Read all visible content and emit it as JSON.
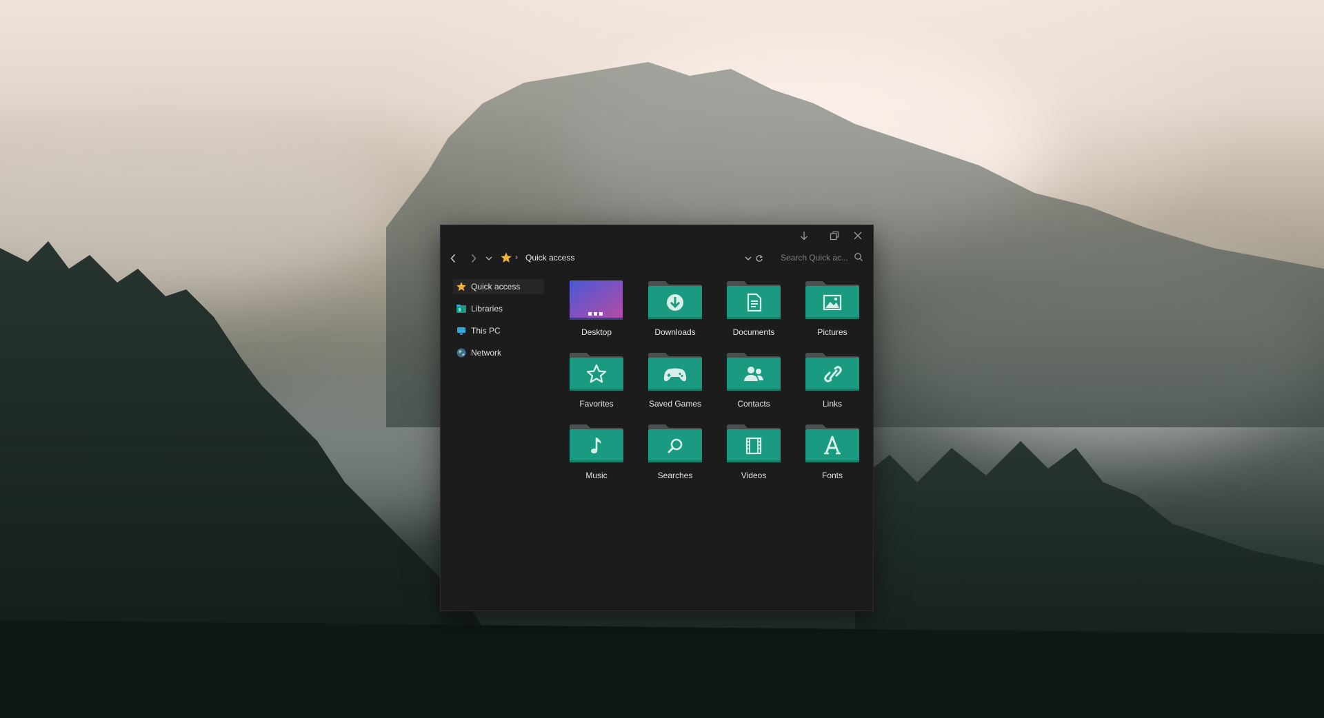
{
  "window": {
    "toolbar": {
      "location": "Quick access",
      "search_placeholder": "Search Quick ac..."
    }
  },
  "sidebar": {
    "items": [
      {
        "label": "Quick access",
        "icon": "star-icon"
      },
      {
        "label": "Libraries",
        "icon": "libraries-icon"
      },
      {
        "label": "This PC",
        "icon": "computer-icon"
      },
      {
        "label": "Network",
        "icon": "globe-icon"
      }
    ]
  },
  "folders": [
    {
      "label": "Desktop",
      "icon": "desktop-folder-icon"
    },
    {
      "label": "Downloads",
      "icon": "download-folder-icon"
    },
    {
      "label": "Documents",
      "icon": "document-folder-icon"
    },
    {
      "label": "Pictures",
      "icon": "picture-folder-icon"
    },
    {
      "label": "Favorites",
      "icon": "star-folder-icon"
    },
    {
      "label": "Saved Games",
      "icon": "gamepad-folder-icon"
    },
    {
      "label": "Contacts",
      "icon": "contacts-folder-icon"
    },
    {
      "label": "Links",
      "icon": "link-folder-icon"
    },
    {
      "label": "Music",
      "icon": "music-folder-icon"
    },
    {
      "label": "Searches",
      "icon": "search-folder-icon"
    },
    {
      "label": "Videos",
      "icon": "film-folder-icon"
    },
    {
      "label": "Fonts",
      "icon": "font-folder-icon"
    }
  ],
  "colors": {
    "folder_body": "#1a9a80",
    "folder_tab": "#4a5050",
    "window_bg": "#1c1c1c",
    "star": "#f3b43c"
  }
}
